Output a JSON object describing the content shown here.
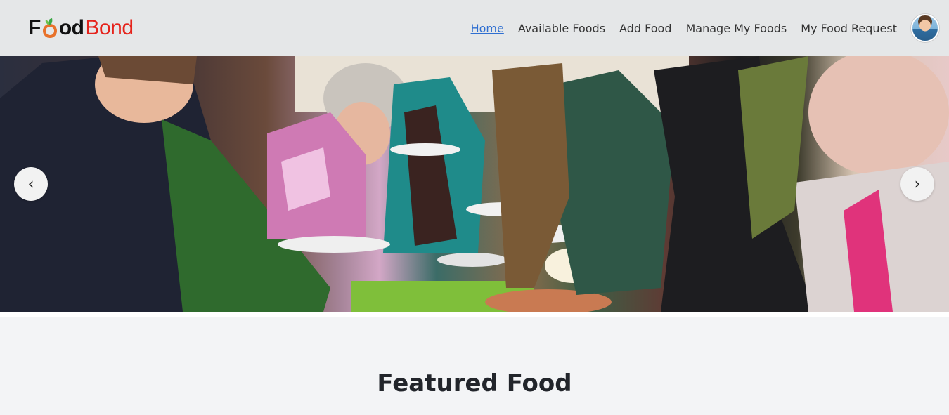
{
  "brand": {
    "name_part1": "F",
    "name_part2": "od",
    "name_part3": "Bond"
  },
  "nav": {
    "links": [
      {
        "label": "Home",
        "active": true
      },
      {
        "label": "Available Foods",
        "active": false
      },
      {
        "label": "Add Food",
        "active": false
      },
      {
        "label": "Manage My Foods",
        "active": false
      },
      {
        "label": "My Food Request",
        "active": false
      }
    ]
  },
  "carousel": {
    "prev_label": "‹",
    "next_label": "›"
  },
  "sections": {
    "featured_title": "Featured Food"
  },
  "colors": {
    "nav_bg": "#e5e7e8",
    "active_link": "#2f6fd1",
    "brand_red": "#e5231b",
    "page_bg": "#f3f4f6"
  }
}
